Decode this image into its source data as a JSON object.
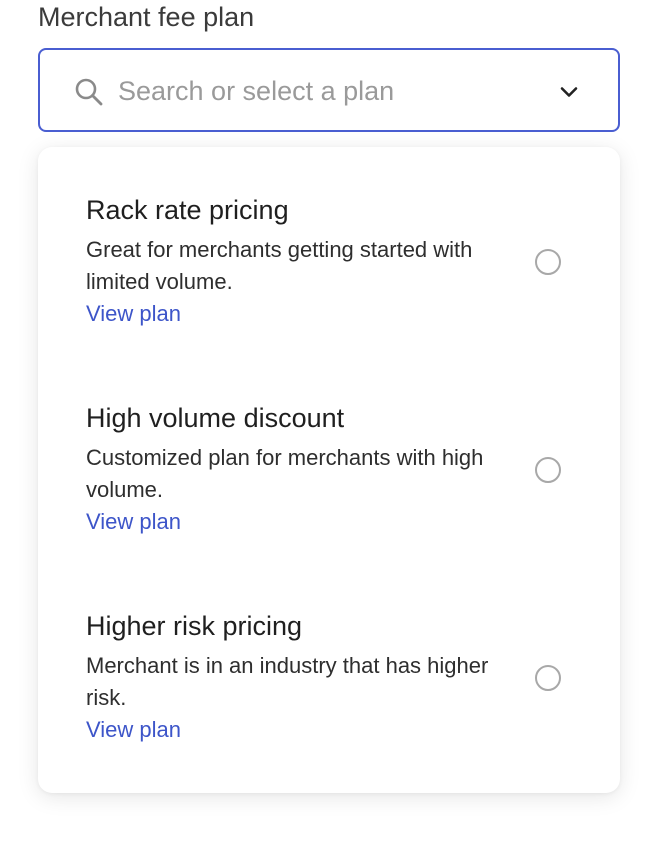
{
  "field": {
    "label": "Merchant fee plan",
    "placeholder": "Search or select a plan",
    "value": "",
    "search_icon": "search-icon",
    "dropdown_icon": "chevron-down-icon"
  },
  "colors": {
    "focus_border": "#4a5ed1",
    "link": "#3d55c9",
    "placeholder": "#9a9a9a"
  },
  "options": [
    {
      "title": "Rack rate pricing",
      "description": "Great for merchants getting started with limited volume.",
      "link_label": "View plan",
      "selected": false
    },
    {
      "title": "High volume discount",
      "description": "Customized plan for merchants with high volume.",
      "link_label": "View plan",
      "selected": false
    },
    {
      "title": "Higher risk pricing",
      "description": "Merchant is in an industry that has higher risk.",
      "link_label": "View plan",
      "selected": false
    }
  ]
}
